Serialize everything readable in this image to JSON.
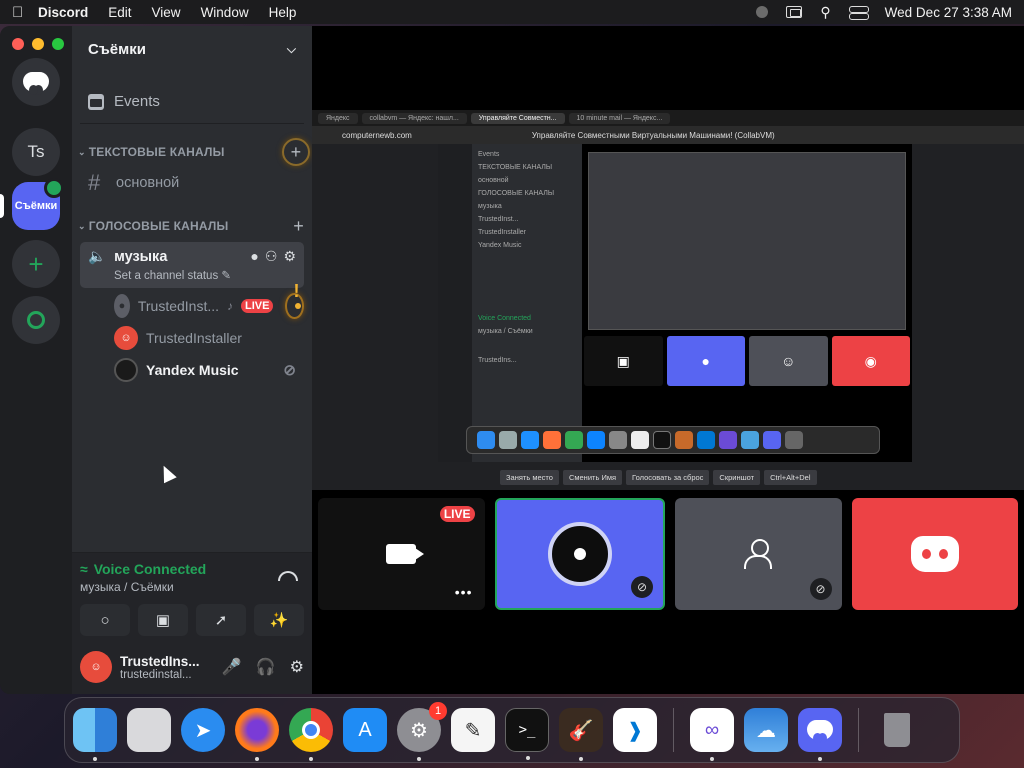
{
  "menubar": {
    "app": "Discord",
    "items": [
      "Edit",
      "View",
      "Window",
      "Help"
    ],
    "datetime": "Wed Dec 27  3:38 AM"
  },
  "rail": {
    "ts_label": "Ts",
    "active_label": "Съёмки"
  },
  "guild": {
    "name": "Съёмки",
    "events_label": "Events",
    "text_category": "ТЕКСТОВЫЕ КАНАЛЫ",
    "text_channel": "основной",
    "voice_category": "ГОЛОСОВЫЕ КАНАЛЫ",
    "voice_channel": "музыка",
    "channel_status": "Set a channel status",
    "members": [
      {
        "name": "TrustedInst...",
        "live": "LIVE"
      },
      {
        "name": "TrustedInstaller"
      },
      {
        "name": "Yandex Music"
      }
    ]
  },
  "voice_panel": {
    "title": "Voice Connected",
    "subtitle": "музыка / Съёмки"
  },
  "user": {
    "display": "TrustedIns...",
    "tag": "trustedinstal..."
  },
  "stream": {
    "tabs": [
      "Яндекс",
      "collabvm — Яндекс: нашл...",
      "Управляйте Совместн...",
      "10 minute mail — Яндекс..."
    ],
    "url": "computernewb.com",
    "page_title": "Управляйте Совместными Виртуальными Машинами! (CollabVM)",
    "vm_sidebar": [
      "Events",
      "ТЕКСТОВЫЕ КАНАЛЫ",
      "основной",
      "ГОЛОСОВЫЕ КАНАЛЫ",
      "музыка",
      "TrustedInst...",
      "TrustedInstaller",
      "Yandex Music",
      "Voice Connected",
      "музыка / Съёмки",
      "TrustedIns..."
    ],
    "toolbar": [
      "Занять место",
      "Сменить Имя",
      "Голосовать за сброс",
      "Скриншот",
      "Ctrl+Alt+Del"
    ]
  },
  "tiles": {
    "live_label": "LIVE"
  },
  "dock": {
    "settings_badge": "1",
    "apps": [
      "finder",
      "launchpad",
      "safari",
      "firefox",
      "chrome",
      "app-store",
      "system-settings",
      "textedit",
      "terminal",
      "garageband",
      "vscode",
      "visual-studio",
      "weather",
      "discord",
      "trash"
    ]
  }
}
